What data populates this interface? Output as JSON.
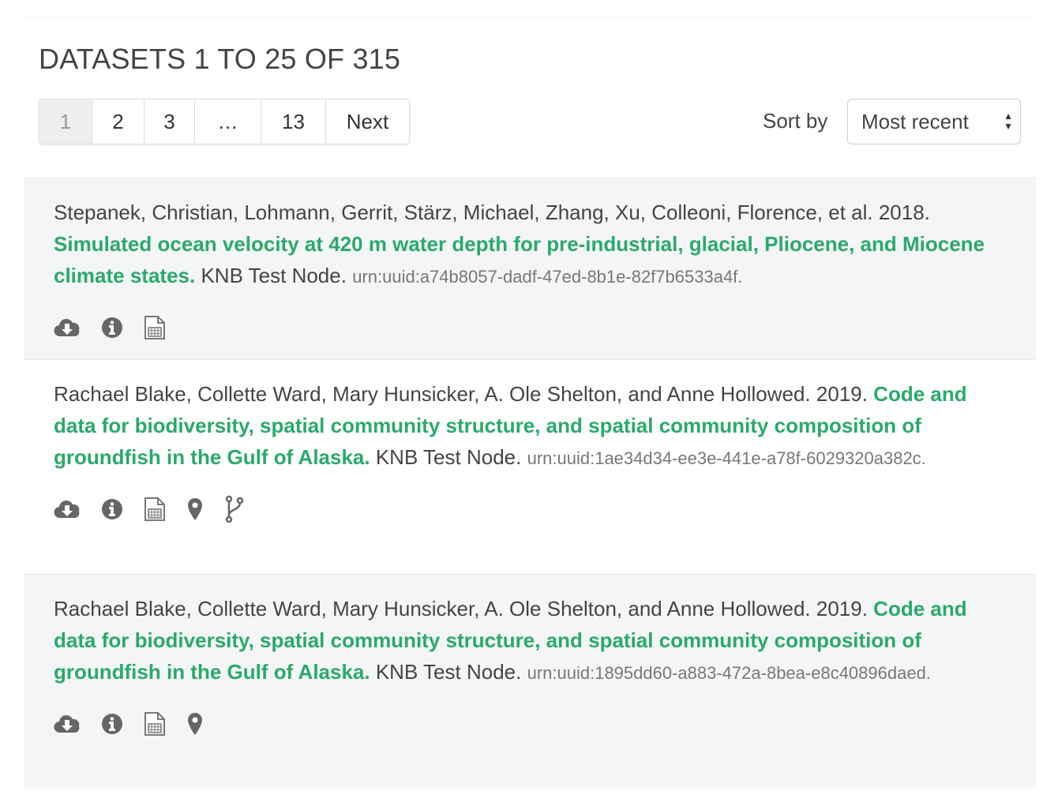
{
  "heading": "DATASETS 1 TO 25 OF 315",
  "pagination": [
    "1",
    "2",
    "3",
    "…",
    "13",
    "Next"
  ],
  "sort": {
    "label": "Sort by",
    "selected": "Most recent"
  },
  "colors": {
    "title": "#2aaa6a",
    "icon": "#666666",
    "row_alt": "#f4f5f7"
  },
  "results": [
    {
      "authors": "Stepanek, Christian, Lohmann, Gerrit, Stärz, Michael, Zhang, Xu, Colleoni, Florence, et al. 2018.",
      "title": "Simulated ocean velocity at 420 m water depth for pre-industrial, glacial, Pliocene, and Miocene climate states.",
      "repo": "KNB Test Node.",
      "id": "urn:uuid:a74b8057-dadf-47ed-8b1e-82f7b6533a4f.",
      "icons": [
        "cloud-download-icon",
        "info-icon",
        "data-table-icon"
      ]
    },
    {
      "authors": "Rachael Blake, Collette Ward, Mary Hunsicker, A. Ole Shelton, and Anne Hollowed. 2019.",
      "title": "Code and data for biodiversity, spatial community structure, and spatial community composition of groundfish in the Gulf of Alaska.",
      "repo": "KNB Test Node.",
      "id": "urn:uuid:1ae34d34-ee3e-441e-a78f-6029320a382c.",
      "icons": [
        "cloud-download-icon",
        "info-icon",
        "data-table-icon",
        "map-marker-icon",
        "code-fork-icon"
      ]
    },
    {
      "authors": "Rachael Blake, Collette Ward, Mary Hunsicker, A. Ole Shelton, and Anne Hollowed. 2019.",
      "title": "Code and data for biodiversity, spatial community structure, and spatial community composition of groundfish in the Gulf of Alaska.",
      "repo": "KNB Test Node.",
      "id": "urn:uuid:1895dd60-a883-472a-8bea-e8c40896daed.",
      "icons": [
        "cloud-download-icon",
        "info-icon",
        "data-table-icon",
        "map-marker-icon"
      ]
    }
  ]
}
